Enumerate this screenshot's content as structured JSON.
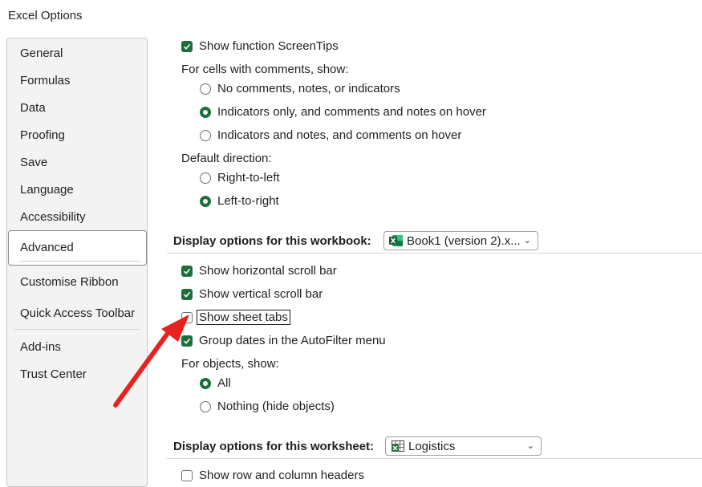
{
  "window": {
    "title": "Excel Options"
  },
  "nav": {
    "items": [
      "General",
      "Formulas",
      "Data",
      "Proofing",
      "Save",
      "Language",
      "Accessibility",
      "Advanced",
      "Customise Ribbon",
      "Quick Access Toolbar",
      "Add-ins",
      "Trust Center"
    ],
    "selected": "Advanced"
  },
  "content": {
    "show_function_screentips": {
      "label": "Show function ScreenTips",
      "checked": true
    },
    "comments": {
      "label": "For cells with comments, show:",
      "options": [
        "No comments, notes, or indicators",
        "Indicators only, and comments and notes on hover",
        "Indicators and notes, and comments on hover"
      ],
      "selected_index": 1
    },
    "direction": {
      "label": "Default direction:",
      "options": [
        "Right-to-left",
        "Left-to-right"
      ],
      "selected_index": 1
    },
    "workbook_section": {
      "label": "Display options for this workbook:",
      "dropdown_value": "Book1 (version 2).x...",
      "options": [
        {
          "label": "Show horizontal scroll bar",
          "checked": true
        },
        {
          "label": "Show vertical scroll bar",
          "checked": true
        },
        {
          "label": "Show sheet tabs",
          "checked": false
        },
        {
          "label": "Group dates in the AutoFilter menu",
          "checked": true
        }
      ],
      "objects_label": "For objects, show:",
      "objects_options": [
        "All",
        "Nothing (hide objects)"
      ],
      "objects_selected_index": 0
    },
    "worksheet_section": {
      "label": "Display options for this worksheet:",
      "dropdown_value": "Logistics",
      "options": [
        {
          "label": "Show row and column headers",
          "checked": false
        }
      ]
    }
  },
  "colors": {
    "accent": "#1e6e3c",
    "annotation_arrow": "#e8231f"
  }
}
